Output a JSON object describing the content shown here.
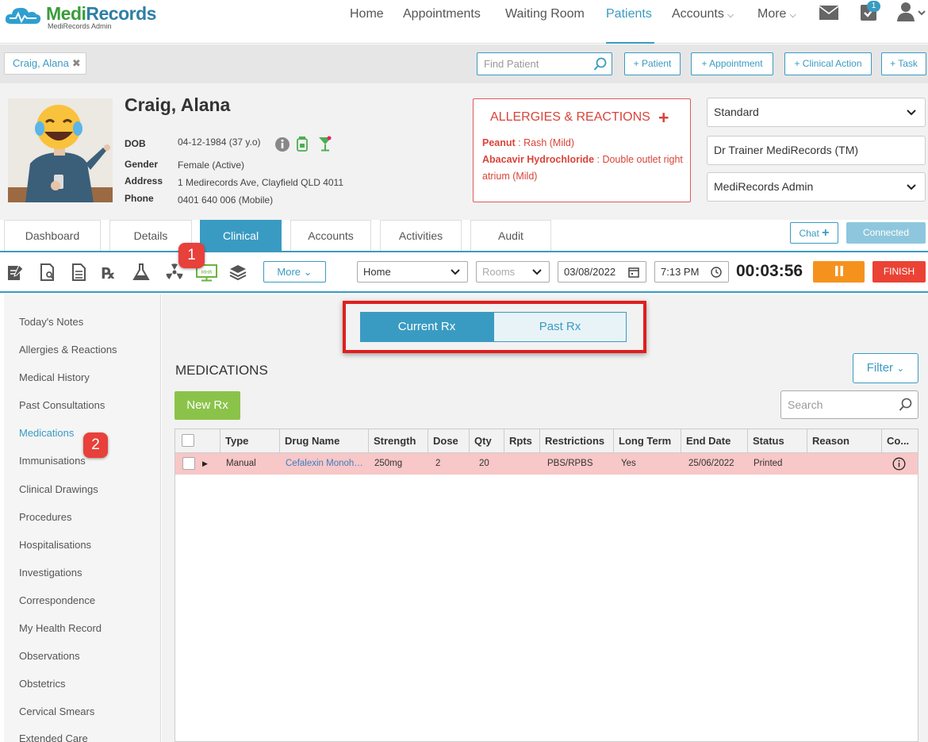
{
  "brand": {
    "name_a": "Medi",
    "name_b": "Records",
    "subtitle": "MediRecords Admin"
  },
  "nav": {
    "home": "Home",
    "appointments": "Appointments",
    "waiting_room": "Waiting Room",
    "patients": "Patients",
    "accounts": "Accounts",
    "more": "More",
    "task_badge": "1"
  },
  "patient_tab": {
    "label": "Craig, Alana"
  },
  "find": {
    "placeholder": "Find Patient"
  },
  "quick_actions": {
    "patient": "+ Patient",
    "appointment": "+ Appointment",
    "clinical_action": "+ Clinical Action",
    "task": "+ Task"
  },
  "patient": {
    "name": "Craig, Alana",
    "dob_label": "DOB",
    "dob": "04-12-1984 (37 y.o)",
    "gender_label": "Gender",
    "gender": "Female (Active)",
    "address_label": "Address",
    "address": "1 Medirecords Ave, Clayfield QLD 4011",
    "phone_label": "Phone",
    "phone": "0401 640 006 (Mobile)"
  },
  "allergies": {
    "title": "ALLERGIES & REACTIONS",
    "items": [
      {
        "name": "Peanut",
        "reaction": "Rash (Mild)"
      },
      {
        "name": "Abacavir Hydrochloride",
        "reaction": "Double outlet right atrium (Mild)"
      }
    ]
  },
  "selectors": {
    "billing": "Standard",
    "doctor": "Dr Trainer MediRecords (TM)",
    "user": "MediRecords Admin"
  },
  "module_tabs": [
    "Dashboard",
    "Details",
    "Clinical",
    "Accounts",
    "Activities",
    "Audit"
  ],
  "chat": {
    "label": "Chat",
    "connected": "Connected"
  },
  "toolbar": {
    "more": "More",
    "location": "Home",
    "rooms_placeholder": "Rooms",
    "date": "03/08/2022",
    "time": "7:13 PM",
    "timer": "00:03:56",
    "finish": "FINISH",
    "mhr_icon_text": "MHR"
  },
  "callouts": {
    "one": "1",
    "two": "2"
  },
  "sidebar": {
    "items": [
      "Today's Notes",
      "Allergies & Reactions",
      "Medical History",
      "Past Consultations",
      "Medications",
      "Immunisations",
      "Clinical Drawings",
      "Procedures",
      "Hospitalisations",
      "Investigations",
      "Correspondence",
      "My Health Record",
      "Observations",
      "Obstetrics",
      "Cervical Smears",
      "Extended Care"
    ]
  },
  "rx_toggle": {
    "current": "Current Rx",
    "past": "Past Rx"
  },
  "medications": {
    "title": "MEDICATIONS",
    "filter": "Filter",
    "new_rx": "New Rx",
    "search_placeholder": "Search",
    "columns": [
      "Type",
      "Drug Name",
      "Strength",
      "Dose",
      "Qty",
      "Rpts",
      "Restrictions",
      "Long Term",
      "End Date",
      "Status",
      "Reason",
      "Co..."
    ],
    "rows": [
      {
        "type": "Manual",
        "drug": "Cefalexin Monoh…",
        "strength": "250mg",
        "dose": "2",
        "qty": "20",
        "rpts": "",
        "restrictions": "PBS/RPBS",
        "long_term": "Yes",
        "end_date": "25/06/2022",
        "status": "Printed",
        "reason": ""
      }
    ]
  },
  "colors": {
    "primary": "#3a9bc2",
    "alert": "#d9443a",
    "green": "#8bc34a",
    "orange": "#f5921e"
  }
}
